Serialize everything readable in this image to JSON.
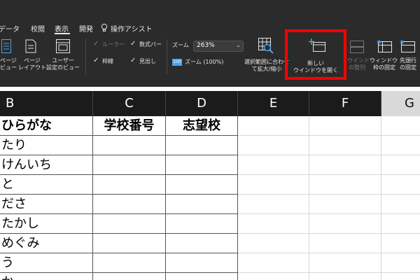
{
  "ribbon": {
    "tabs": [
      {
        "label": "データ"
      },
      {
        "label": "校閲"
      },
      {
        "label": "表示",
        "active": true
      },
      {
        "label": "開発"
      }
    ],
    "assist_label": "操作アシスト",
    "views": {
      "page_layout_line1": "ページ",
      "page_layout_line2": "レイアウト",
      "page_prefix_line1": "ページ",
      "page_prefix_line2": "ビュー",
      "user_view_line1": "ユーザー",
      "user_view_line2": "設定のビュー"
    },
    "show": {
      "ruler": "ルーラー",
      "formula_bar": "数式バー",
      "gridlines": "枠線",
      "headings": "見出し"
    },
    "zoom": {
      "label": "ズーム",
      "value": "263%",
      "zoom100": "ズーム (100%)",
      "zoom100_badge": "100"
    },
    "zoom_selection_line1": "選択範囲に合わせ",
    "zoom_selection_line2": "て拡大/縮小",
    "new_window_line1": "新しい",
    "new_window_line2": "ウインドウを開く",
    "arrange_line1": "ウインドウ",
    "arrange_line2": "の整列",
    "freeze_line1": "ウィンドウ",
    "freeze_line2": "枠の固定",
    "freeze_top_line1": "先頭行",
    "freeze_top_line2": "の固定"
  },
  "colors": {
    "ribbon_bg": "#2b2b2b",
    "highlight": "#ff0000",
    "header_dark": "#1b1b1b",
    "header_selected": "#d9d9d9"
  },
  "sheet": {
    "columns": [
      "B",
      "C",
      "D",
      "E",
      "F",
      "G"
    ],
    "table_headers": [
      "ひらがな",
      "学校番号",
      "志望校"
    ],
    "rows": [
      "たり",
      "けんいち",
      "と",
      "ださ",
      "たかし",
      "めぐみ",
      "う",
      "か"
    ]
  }
}
